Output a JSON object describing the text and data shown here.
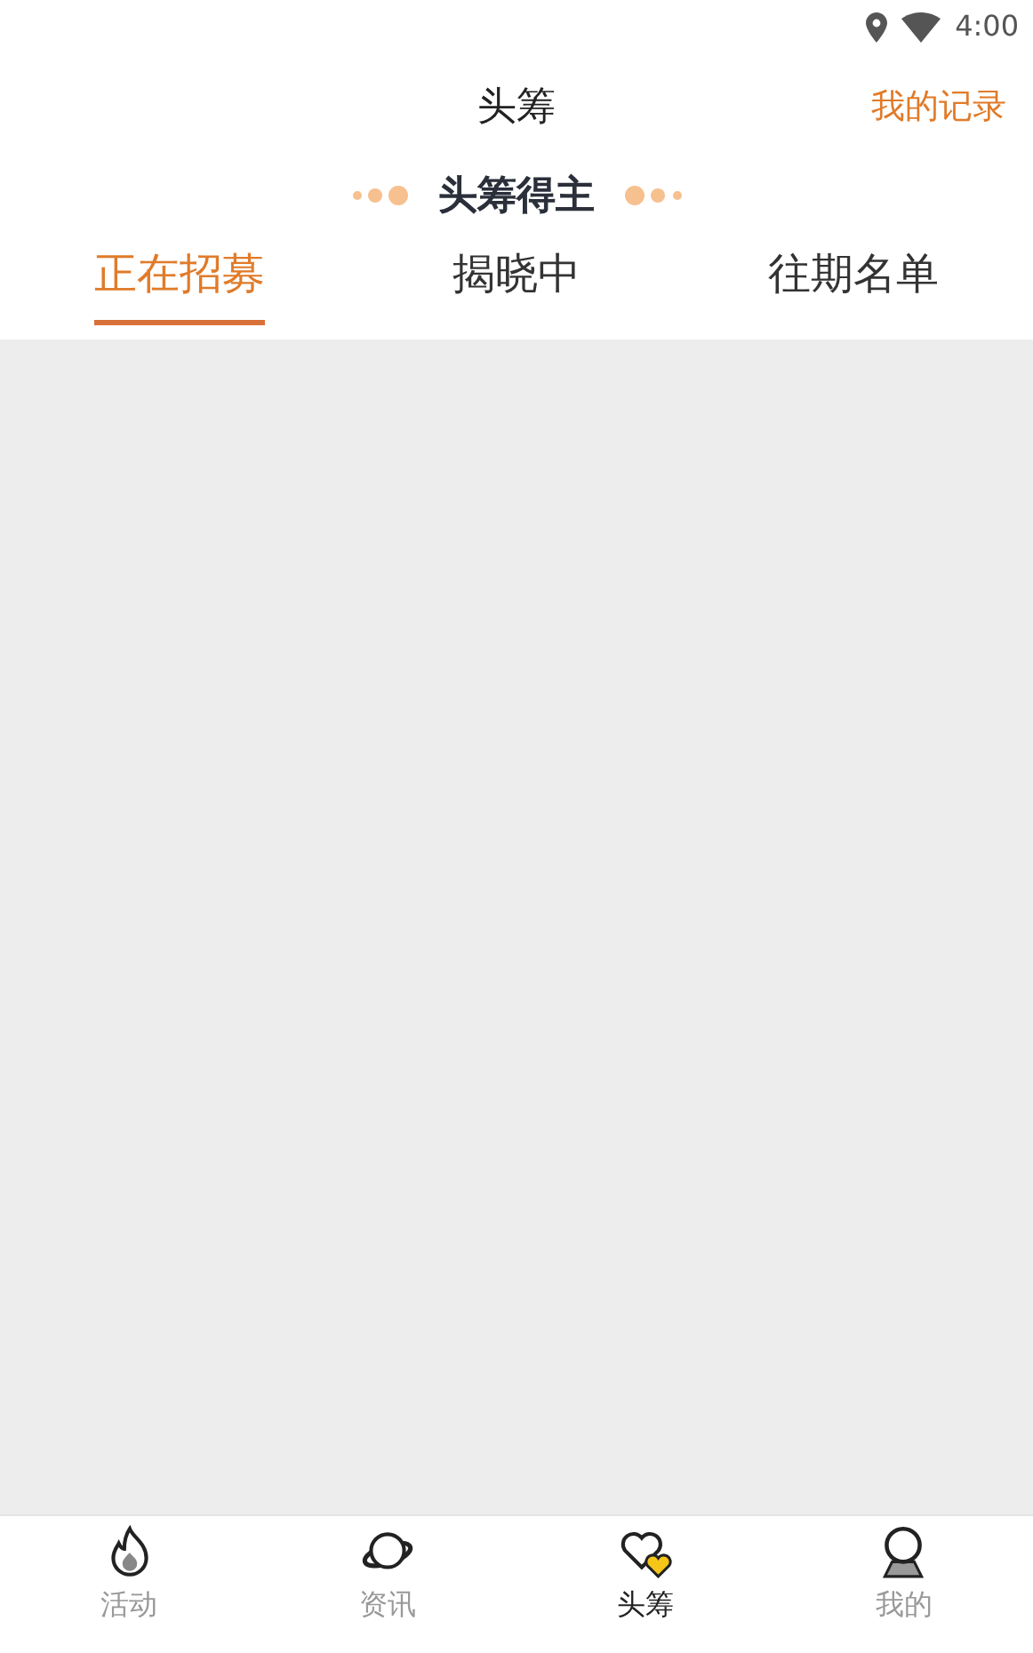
{
  "status_bar": {
    "time": "4:00"
  },
  "header": {
    "title": "头筹",
    "action": "我的记录"
  },
  "section_title": "头筹得主",
  "tabs": [
    {
      "label": "正在招募",
      "selected": true
    },
    {
      "label": "揭晓中",
      "selected": false
    },
    {
      "label": "往期名单",
      "selected": false
    }
  ],
  "bottom_nav": [
    {
      "label": "活动",
      "selected": false
    },
    {
      "label": "资讯",
      "selected": false
    },
    {
      "label": "头筹",
      "selected": true
    },
    {
      "label": "我的",
      "selected": false
    }
  ]
}
